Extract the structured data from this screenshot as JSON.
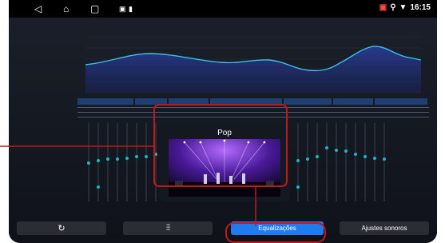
{
  "statusbar": {
    "time": "16:15",
    "nav_icons": [
      "back-icon",
      "home-icon",
      "recents-icon"
    ],
    "notification_icons": [
      "gallery-icon",
      "battery-icon"
    ],
    "system_icons": [
      "no-sim-icon",
      "location-icon",
      "wifi-icon"
    ]
  },
  "popup": {
    "title": "Pop"
  },
  "bottom_bar": {
    "reset_icon": "refresh-icon",
    "sliders_icon": "equalizer-sliders-icon",
    "equalizations_label": "Equalizações",
    "sound_settings_label": "Ajustes sonoros",
    "active_tab": "Equalizações"
  },
  "colors": {
    "accent": "#1e7cf0",
    "slider_dot": "#1bb7c8",
    "callout": "#c0191d",
    "curve": "#39c2e6",
    "band_header": "#1f3f74"
  }
}
